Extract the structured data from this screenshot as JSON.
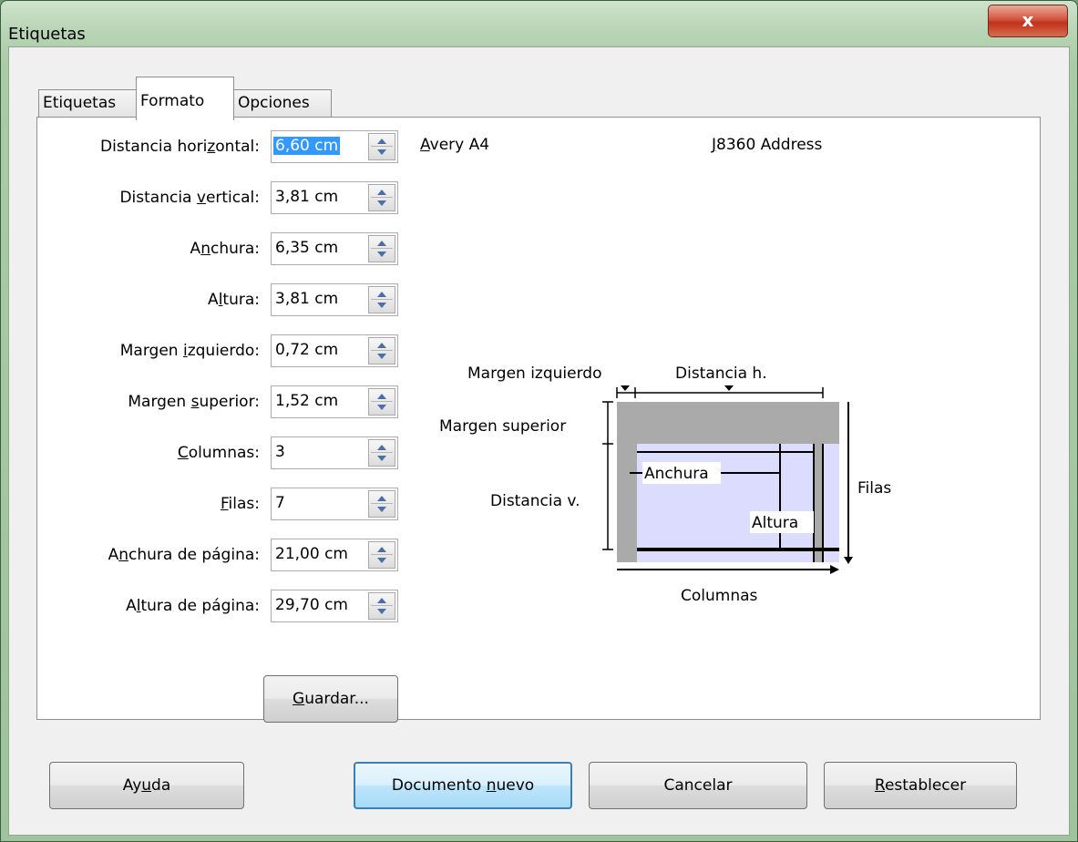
{
  "window": {
    "title": "Etiquetas",
    "close_glyph": "x"
  },
  "tabs": [
    {
      "label": "Etiquetas",
      "active": false
    },
    {
      "label": "Formato",
      "active": true
    },
    {
      "label": "Opciones",
      "active": false
    }
  ],
  "fields": [
    {
      "pre": "Distancia hori",
      "key": "z",
      "post": "ontal:",
      "value": "6,60 cm"
    },
    {
      "pre": "Distancia ",
      "key": "v",
      "post": "ertical:",
      "value": "3,81 cm"
    },
    {
      "pre": "A",
      "key": "n",
      "post": "chura:",
      "value": "6,35 cm"
    },
    {
      "pre": "A",
      "key": "l",
      "post": "tura:",
      "value": "3,81 cm"
    },
    {
      "pre": "Margen ",
      "key": "i",
      "post": "zquierdo:",
      "value": "0,72 cm"
    },
    {
      "pre": "Margen ",
      "key": "s",
      "post": "uperior:",
      "value": "1,52 cm"
    },
    {
      "pre": "",
      "key": "C",
      "post": "olumnas:",
      "value": "3"
    },
    {
      "pre": "",
      "key": "F",
      "post": "ilas:",
      "value": "7"
    },
    {
      "pre": "A",
      "key": "n",
      "post": "chura de página:",
      "value": "21,00 cm"
    },
    {
      "pre": "A",
      "key": "l",
      "post": "tura de página:",
      "value": "29,70 cm"
    }
  ],
  "save_button": {
    "key": "G",
    "post": "uardar..."
  },
  "brand": {
    "key": "A",
    "post": "very A4"
  },
  "product": {
    "key": "J",
    "post": "8360 Address"
  },
  "diagram": {
    "left_margin": "Margen izquierdo",
    "h_distance": "Distancia h.",
    "top_margin": "Margen superior",
    "v_distance": "Distancia v.",
    "width": "Anchura",
    "height": "Altura",
    "rows": "Filas",
    "columns": "Columnas"
  },
  "buttons": {
    "help": {
      "pre": "Ay",
      "key": "u",
      "post": "da"
    },
    "new_doc": {
      "pre": "Documento ",
      "key": "n",
      "post": "uevo"
    },
    "cancel": {
      "label": "Cancelar"
    },
    "reset": {
      "pre": "",
      "key": "R",
      "post": "establecer"
    }
  }
}
